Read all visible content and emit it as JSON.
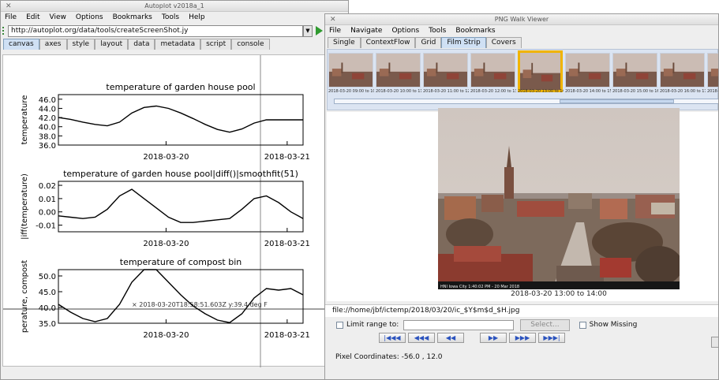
{
  "autoplot": {
    "title": "Autoplot v2018a_1",
    "menu": [
      "File",
      "Edit",
      "View",
      "Options",
      "Bookmarks",
      "Tools",
      "Help"
    ],
    "url": "http://autoplot.org/data/tools/createScreenShot.jy",
    "tabs": [
      "canvas",
      "axes",
      "style",
      "layout",
      "data",
      "metadata",
      "script",
      "console"
    ],
    "active_tab": "canvas",
    "crosshair_readout": "× 2018-03-20T18:58:51.603Z y:39.4 deg F"
  },
  "chart_data": [
    {
      "type": "line",
      "title": "temperature of garden house pool",
      "ylabel": "temperature",
      "xlabel": "",
      "x_ticks": [
        "2018-03-20",
        "2018-03-21"
      ],
      "y_ticks": [
        "36.0",
        "38.0",
        "40.0",
        "42.0",
        "44.0",
        "46.0"
      ],
      "ylim": [
        36,
        47
      ],
      "x": [
        0,
        0.1,
        0.2,
        0.3,
        0.4,
        0.5,
        0.6,
        0.7,
        0.8,
        0.9,
        1.0,
        1.1,
        1.2,
        1.3,
        1.4,
        1.5,
        1.6,
        1.7,
        1.8,
        1.9,
        2.0
      ],
      "y": [
        42.0,
        41.6,
        41.0,
        40.5,
        40.2,
        41.0,
        43.0,
        44.2,
        44.5,
        44.0,
        43.0,
        41.8,
        40.5,
        39.4,
        38.8,
        39.5,
        40.8,
        41.5,
        41.5,
        41.5,
        41.5
      ]
    },
    {
      "type": "line",
      "title": "temperature of garden house pool|diff()|smoothfit(51)",
      "ylabel": "|iff(temperature)",
      "xlabel": "",
      "x_ticks": [
        "2018-03-20",
        "2018-03-21"
      ],
      "y_ticks": [
        "-0.01",
        "0.00",
        "0.01",
        "0.02"
      ],
      "ylim": [
        -0.015,
        0.023
      ],
      "x": [
        0,
        0.1,
        0.2,
        0.3,
        0.4,
        0.5,
        0.6,
        0.7,
        0.8,
        0.9,
        1.0,
        1.1,
        1.2,
        1.3,
        1.4,
        1.5,
        1.6,
        1.7,
        1.8,
        1.9,
        2.0
      ],
      "y": [
        -0.003,
        -0.004,
        -0.005,
        -0.004,
        0.002,
        0.012,
        0.017,
        0.01,
        0.003,
        -0.004,
        -0.008,
        -0.008,
        -0.007,
        -0.006,
        -0.005,
        0.002,
        0.01,
        0.012,
        0.007,
        0.0,
        -0.005
      ]
    },
    {
      "type": "line",
      "title": "temperature of compost bin",
      "ylabel": "perature, compost",
      "xlabel": "",
      "x_ticks": [
        "2018-03-20",
        "2018-03-21"
      ],
      "y_ticks": [
        "35.0",
        "40.0",
        "45.0",
        "50.0"
      ],
      "ylim": [
        35,
        52
      ],
      "x": [
        0,
        0.1,
        0.2,
        0.3,
        0.4,
        0.5,
        0.6,
        0.7,
        0.8,
        0.9,
        1.0,
        1.1,
        1.2,
        1.3,
        1.4,
        1.5,
        1.6,
        1.7,
        1.8,
        1.9,
        2.0
      ],
      "y": [
        41.0,
        38.5,
        36.5,
        35.5,
        36.5,
        41.0,
        48.0,
        53.0,
        52.0,
        48.0,
        44.0,
        40.5,
        38.0,
        36.0,
        35.2,
        38.0,
        43.0,
        46.0,
        45.5,
        46.0,
        44.0
      ]
    }
  ],
  "pngwalk": {
    "title": "PNG Walk Viewer",
    "menu": [
      "File",
      "Navigate",
      "Options",
      "Tools",
      "Bookmarks"
    ],
    "tabs": [
      "Single",
      "ContextFlow",
      "Grid",
      "Film Strip",
      "Covers"
    ],
    "active_tab": "Film Strip",
    "thumbnails": [
      "2018-03-20 09:00 to 10:00",
      "2018-03-20 10:00 to 11:00",
      "2018-03-20 11:00 to 12:00",
      "2018-03-20 12:00 to 13:00",
      "2018-03-20 13:00 to 14:00",
      "2018-03-20 14:00 to 15:00",
      "2018-03-20 15:00 to 16:00",
      "2018-03-20 16:00 to 17:00",
      "2018-03-20 17:00 to 18:00"
    ],
    "selected_index": 4,
    "image_overlay": "HNI Iowa City  1:40:02 PM - 20 Mar 2018",
    "caption": "2018-03-20 13:00 to 14:00",
    "file_path": "file://home/jbf/ictemp/2018/03/20/ic_$Y$m$d_$H.jpg",
    "limit_label": "Limit range to:",
    "select_label": "Select...",
    "show_missing_label": "Show Missing",
    "nav_buttons": [
      "|◀◀◀",
      "◀◀◀",
      "◀◀",
      "▶▶",
      "▶▶▶",
      "▶▶▶|"
    ],
    "pixel_coords": "Pixel Coordinates: -56.0 , 12.0"
  }
}
